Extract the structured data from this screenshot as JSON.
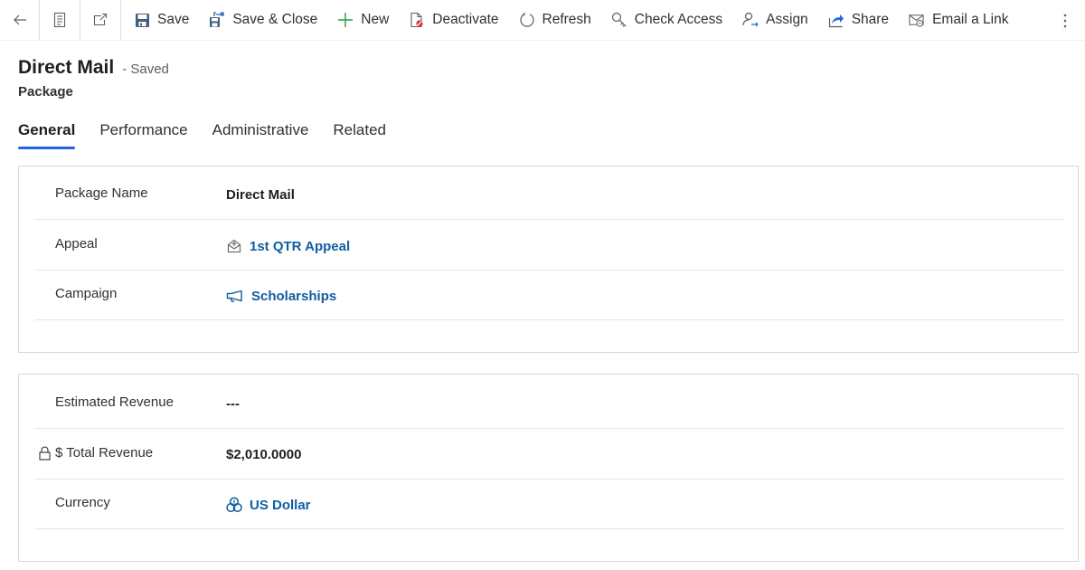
{
  "command_bar": {
    "back": {
      "icon": "back-arrow-icon"
    },
    "form_view": {
      "icon": "form-icon"
    },
    "pop_out": {
      "icon": "open-in-new-window-icon"
    },
    "buttons": [
      {
        "label": "Save",
        "icon": "save-icon"
      },
      {
        "label": "Save & Close",
        "icon": "save-and-close-icon"
      },
      {
        "label": "New",
        "icon": "plus-icon"
      },
      {
        "label": "Deactivate",
        "icon": "deactivate-icon"
      },
      {
        "label": "Refresh",
        "icon": "refresh-icon"
      },
      {
        "label": "Check Access",
        "icon": "key-icon"
      },
      {
        "label": "Assign",
        "icon": "assign-icon"
      },
      {
        "label": "Share",
        "icon": "share-icon"
      },
      {
        "label": "Email a Link",
        "icon": "email-link-icon"
      }
    ],
    "more": {
      "icon": "more-vertical-icon"
    }
  },
  "header": {
    "title": "Direct Mail",
    "status": "- Saved",
    "entity": "Package"
  },
  "tabs": [
    {
      "label": "General",
      "active": true
    },
    {
      "label": "Performance",
      "active": false
    },
    {
      "label": "Administrative",
      "active": false
    },
    {
      "label": "Related",
      "active": false
    }
  ],
  "sections": [
    {
      "fields": [
        {
          "label": "Package Name",
          "value": "Direct Mail",
          "type": "text"
        },
        {
          "label": "Appeal",
          "value": "1st QTR Appeal",
          "type": "lookup",
          "icon": "appeal-envelope-icon"
        },
        {
          "label": "Campaign",
          "value": "Scholarships",
          "type": "lookup",
          "icon": "campaign-megaphone-icon"
        }
      ]
    },
    {
      "fields": [
        {
          "label": "Estimated Revenue",
          "value": "---",
          "type": "text"
        },
        {
          "label": "$ Total Revenue",
          "value": "$2,010.0000",
          "type": "text",
          "locked": true
        },
        {
          "label": "Currency",
          "value": "US Dollar",
          "type": "lookup",
          "icon": "currency-icon"
        }
      ]
    }
  ],
  "colors": {
    "accent": "#2266e3",
    "link": "#115ea3",
    "new_icon": "#1f9e3a",
    "save_icon": "#41607f"
  }
}
